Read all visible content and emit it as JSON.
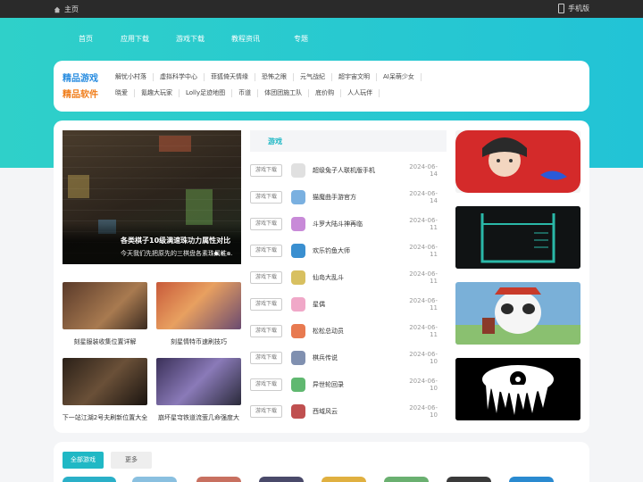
{
  "topbar": {
    "home": "主页",
    "mobile": "手机版"
  },
  "nav": [
    "首页",
    "应用下载",
    "游戏下载",
    "教程资讯",
    "专题"
  ],
  "categories": {
    "games": {
      "tag": "精品游戏",
      "color": "#2a8de0",
      "items": [
        "解忧小村落",
        "虚拟科学中心",
        "菲狐倚天情缘",
        "恐怖之眼",
        "元气战纪",
        "超宇宙文明",
        "AI呆萌少女"
      ]
    },
    "software": {
      "tag": "精品软件",
      "color": "#f07d1a",
      "items": [
        "晓爱",
        "氪趣大玩家",
        "Lolly足迹地图",
        "币道",
        "体团团施工队",
        "底价购",
        "人人玩伴"
      ]
    }
  },
  "banner": {
    "title": "各类棋子10级满速珠功力属性对比",
    "subtitle": "今天我们先把原先的三棋盘各素珠属性..."
  },
  "thumbs": [
    {
      "caption": "刻星服装收集位置详解"
    },
    {
      "caption": "刻星情特币速刷技巧"
    },
    {
      "caption": "下一站江湖2号夫刷新位置大全"
    },
    {
      "caption": "崩坏星穹铁道流萤几命强度大"
    }
  ],
  "tab": {
    "label": "游戏"
  },
  "list": {
    "badge": "游戏下载",
    "rows": [
      {
        "name": "超级兔子人联机版手机",
        "date": "2024-06-14",
        "color": "#e0e0e0"
      },
      {
        "name": "猫魔曲手游官方",
        "date": "2024-06-14",
        "color": "#7ab0e0"
      },
      {
        "name": "斗罗大陆斗神再临",
        "date": "2024-06-11",
        "color": "#c88ad8"
      },
      {
        "name": "欢乐钓鱼大师",
        "date": "2024-06-11",
        "color": "#3a8fd0"
      },
      {
        "name": "仙岛大乱斗",
        "date": "2024-06-11",
        "color": "#d8c060"
      },
      {
        "name": "星偶",
        "date": "2024-06-11",
        "color": "#f0a8c8"
      },
      {
        "name": "松松总动员",
        "date": "2024-06-11",
        "color": "#e87a50"
      },
      {
        "name": "棋兵传说",
        "date": "2024-06-10",
        "color": "#8090b0"
      },
      {
        "name": "异世轮回录",
        "date": "2024-06-10",
        "color": "#60b870"
      },
      {
        "name": "西域风云",
        "date": "2024-06-10",
        "color": "#c05050"
      }
    ]
  },
  "bottom": {
    "all": "全部游戏",
    "more": "更多"
  }
}
